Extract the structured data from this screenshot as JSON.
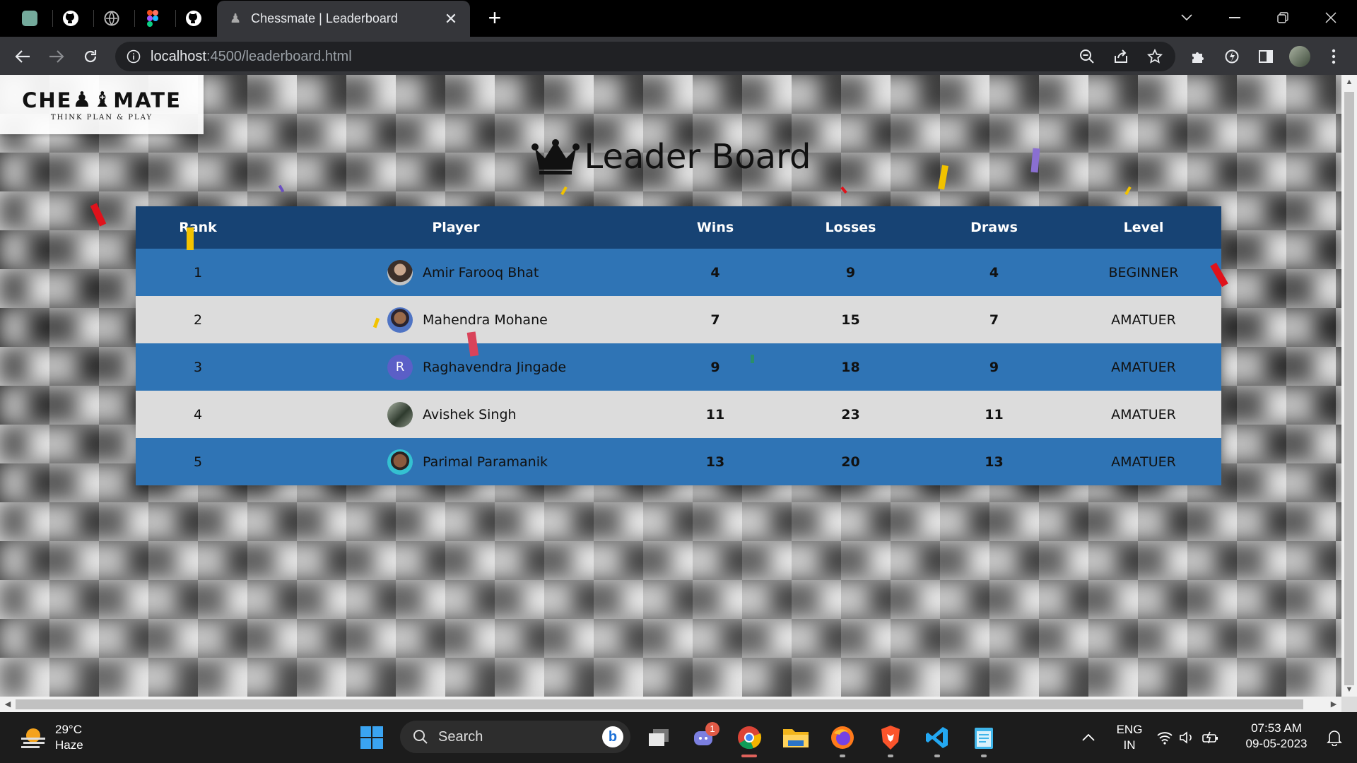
{
  "browser": {
    "active_tab_title": "Chessmate | Leaderboard",
    "url_host": "localhost",
    "url_rest": ":4500/leaderboard.html",
    "new_tab_symbol": "+",
    "close_symbol": "✕",
    "pinned_tabs": [
      "chatgpt-icon",
      "github-icon",
      "globe-icon",
      "figma-icon",
      "github-icon"
    ]
  },
  "page": {
    "logo_text_left": "CHE",
    "logo_text_right": "MATE",
    "logo_tagline": "THINK PLAN & PLAY",
    "heading": "Leader Board",
    "columns": [
      "Rank",
      "Player",
      "Wins",
      "Losses",
      "Draws",
      "Level"
    ],
    "rows": [
      {
        "rank": "1",
        "player": "Amir Farooq Bhat",
        "wins": "4",
        "losses": "9",
        "draws": "4",
        "level": "BEGINNER",
        "avatar": "photo",
        "avatar_color": "#6b5a4e"
      },
      {
        "rank": "2",
        "player": "Mahendra Mohane",
        "wins": "7",
        "losses": "15",
        "draws": "7",
        "level": "AMATUER",
        "avatar": "photo",
        "avatar_color": "#4a6aa5"
      },
      {
        "rank": "3",
        "player": "Raghavendra Jingade",
        "wins": "9",
        "losses": "18",
        "draws": "9",
        "level": "AMATUER",
        "avatar": "letter",
        "avatar_letter": "R"
      },
      {
        "rank": "4",
        "player": "Avishek Singh",
        "wins": "11",
        "losses": "23",
        "draws": "11",
        "level": "AMATUER",
        "avatar": "photo",
        "avatar_color": "#3d5a3c"
      },
      {
        "rank": "5",
        "player": "Parimal Paramanik",
        "wins": "13",
        "losses": "20",
        "draws": "13",
        "level": "AMATUER",
        "avatar": "photo",
        "avatar_color": "#2fb9c9"
      }
    ],
    "colors": {
      "header": "#174374",
      "row_blue": "#2f74b5",
      "row_grey": "#dcdcdc",
      "wins": "#0a7d14",
      "losses": "#e01b24",
      "draws": "#f0a30a"
    }
  },
  "taskbar": {
    "temperature": "29°C",
    "weather": "Haze",
    "search_label": "Search",
    "chat_badge": "1",
    "lang_top": "ENG",
    "lang_bottom": "IN",
    "time": "07:53 AM",
    "date": "09-05-2023"
  }
}
